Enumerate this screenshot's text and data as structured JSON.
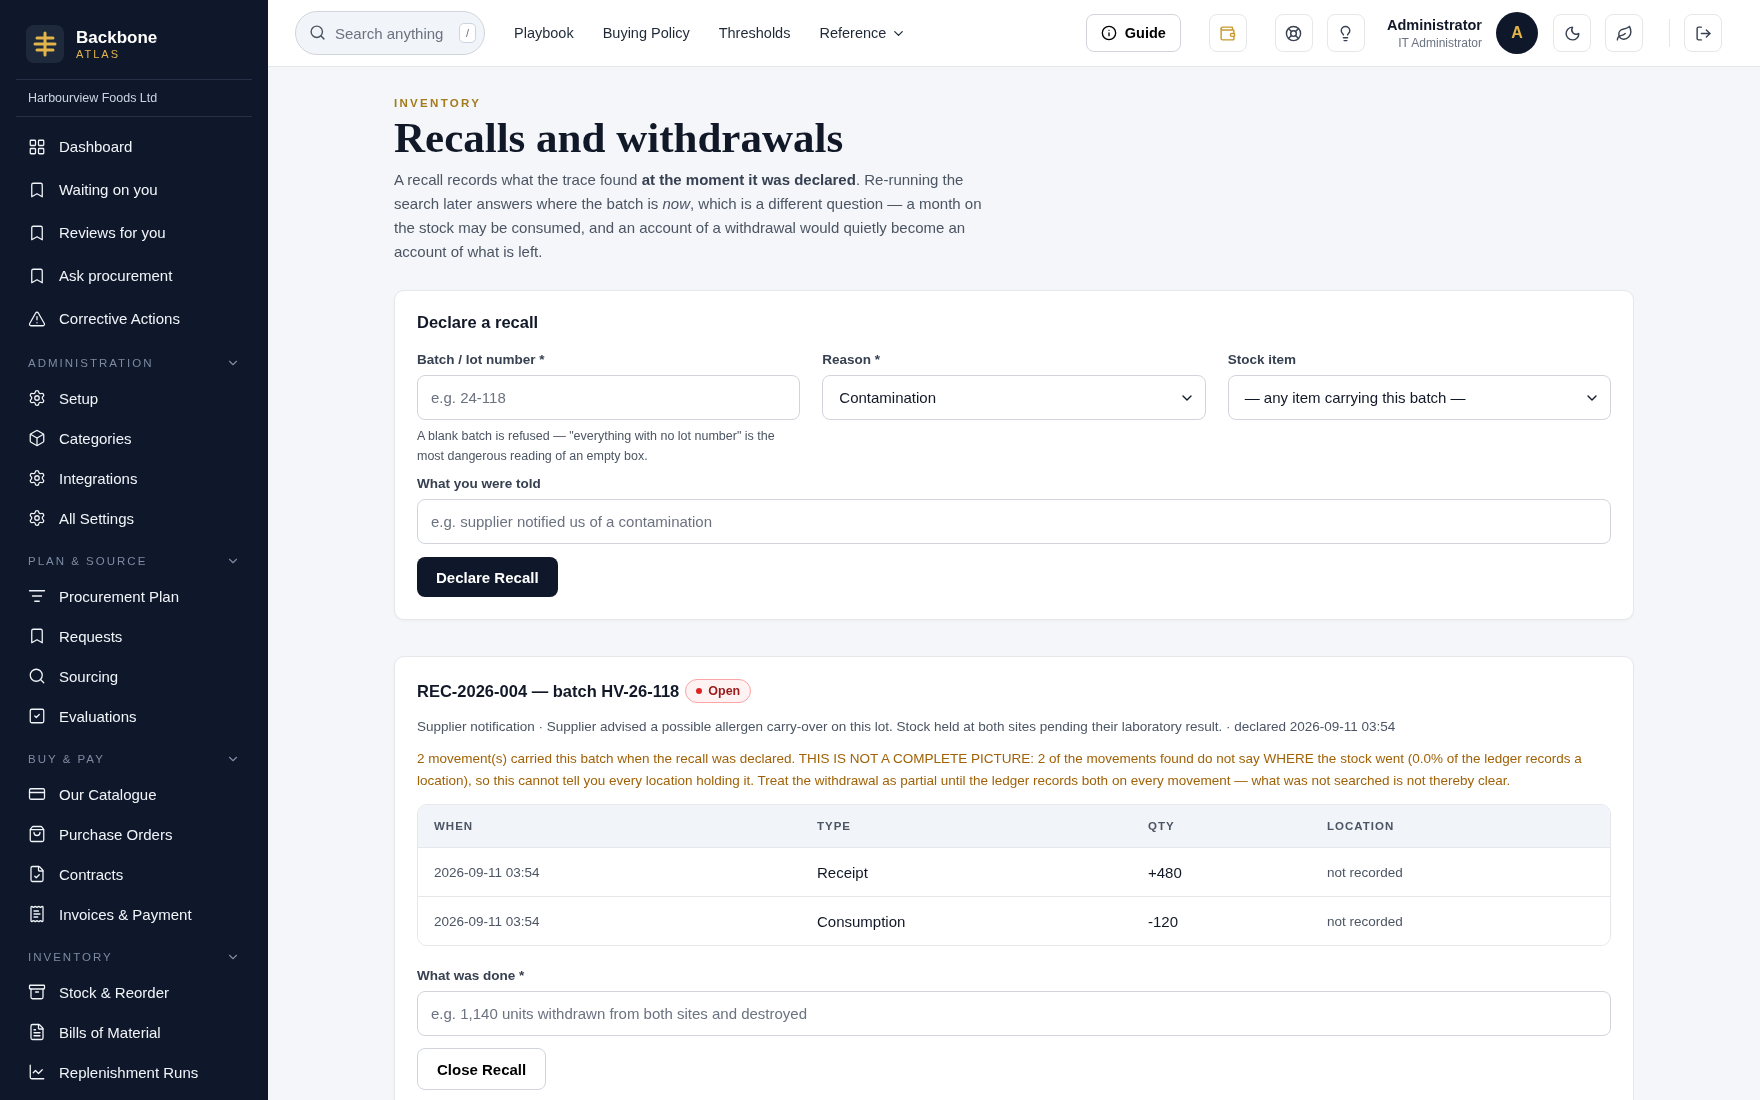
{
  "sidebar": {
    "brand": {
      "name": "Backbone",
      "tagline": "ATLAS"
    },
    "organisation": "Harbourview Foods Ltd",
    "items": [
      {
        "label": "Dashboard",
        "selected": false
      },
      {
        "label": "Waiting on you",
        "selected": false
      },
      {
        "label": "Reviews for you",
        "selected": false
      },
      {
        "label": "Ask procurement",
        "selected": false
      },
      {
        "label": "Corrective Actions",
        "selected": false
      }
    ],
    "sections": [
      {
        "title": "ADMINISTRATION",
        "expanded": true,
        "items": [
          {
            "label": "Setup",
            "selected": false
          },
          {
            "label": "Categories",
            "selected": false
          },
          {
            "label": "Integrations",
            "selected": false
          },
          {
            "label": "All Settings",
            "selected": false
          }
        ]
      },
      {
        "title": "PLAN & SOURCE",
        "expanded": true,
        "items": [
          {
            "label": "Procurement Plan",
            "selected": false
          },
          {
            "label": "Requests",
            "selected": false
          },
          {
            "label": "Sourcing",
            "selected": false
          },
          {
            "label": "Evaluations",
            "selected": false
          }
        ]
      },
      {
        "title": "BUY & PAY",
        "expanded": true,
        "items": [
          {
            "label": "Our Catalogue",
            "selected": false
          },
          {
            "label": "Purchase Orders",
            "selected": false
          },
          {
            "label": "Contracts",
            "selected": false
          },
          {
            "label": "Invoices & Payment",
            "selected": false
          }
        ]
      },
      {
        "title": "INVENTORY",
        "expanded": true,
        "items": [
          {
            "label": "Stock & Reorder",
            "selected": false
          },
          {
            "label": "Bills of Material",
            "selected": false
          },
          {
            "label": "Replenishment Runs",
            "selected": false
          }
        ]
      }
    ]
  },
  "header": {
    "search": {
      "placeholder": "Search anything",
      "shortcut": "/"
    },
    "nav": [
      {
        "label": "Playbook",
        "dropdown": false
      },
      {
        "label": "Buying Policy",
        "dropdown": false
      },
      {
        "label": "Thresholds",
        "dropdown": false
      },
      {
        "label": "Reference",
        "dropdown": true
      }
    ],
    "guide": "Guide",
    "user": {
      "name": "Administrator",
      "role": "IT Administrator",
      "initial": "A"
    }
  },
  "page": {
    "eyebrow": "INVENTORY",
    "title": "Recalls and withdrawals",
    "intro": "A recall records what the trace found **at the moment it was declared**. Re-running the search later answers where the batch is *now*, which is a different question — a month on the stock may be consumed, and an account of a withdrawal would quietly become an account of what is left."
  },
  "declare_form": {
    "title": "Declare a recall",
    "fields": [
      {
        "kind": "text",
        "label": "Batch / lot number *",
        "placeholder": "e.g. 24-118",
        "hint": "A blank batch is refused — \"everything with no lot number\" is the most dangerous reading of an empty box."
      },
      {
        "kind": "select",
        "label": "Reason *",
        "value": "Contamination"
      },
      {
        "kind": "select",
        "label": "Stock item",
        "value": "— any item carrying this batch —"
      }
    ],
    "told": {
      "label": "What you were told",
      "placeholder": "e.g. supplier notified us of a contamination"
    },
    "button": "Declare Recall"
  },
  "recall": {
    "title": "REC-2026-004 — batch HV-26-118",
    "status": {
      "label": "Open",
      "color": "#dc2626"
    },
    "meta": "Supplier notification · Supplier advised a possible allergen carry-over on this lot. Stock held at both sites pending their laboratory result. · declared 2026-09-11 03:54",
    "warning": "2 movement(s) carried this batch when the recall was declared. THIS IS NOT A COMPLETE PICTURE: 2 of the movements found do not say WHERE the stock went (0.0% of the ledger records a location), so this cannot tell you every location holding it. Treat the withdrawal as partial until the ledger records both on every movement — what was not searched is not thereby clear.",
    "table": {
      "columns": [
        "WHEN",
        "TYPE",
        "QTY",
        "LOCATION"
      ],
      "rows": [
        [
          "2026-09-11 03:54",
          "Receipt",
          "+480",
          "not recorded"
        ],
        [
          "2026-09-11 03:54",
          "Consumption",
          "-120",
          "not recorded"
        ]
      ]
    },
    "done": {
      "label": "What was done *",
      "placeholder": "e.g. 1,140 units withdrawn from both sites and destroyed"
    },
    "button": "Close Recall"
  }
}
